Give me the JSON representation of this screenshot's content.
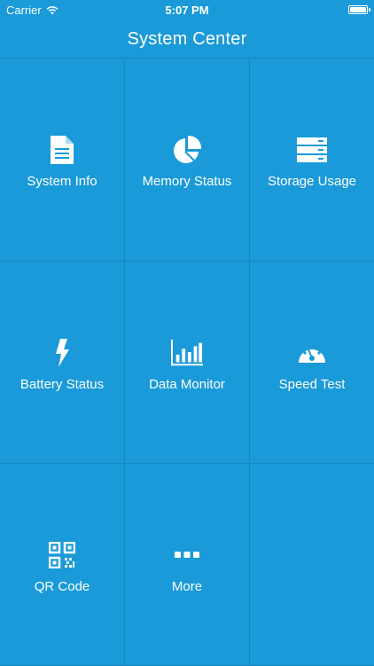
{
  "status_bar": {
    "carrier": "Carrier",
    "time": "5:07 PM"
  },
  "nav": {
    "title": "System Center"
  },
  "tiles": [
    {
      "label": "System Info",
      "icon": "document-icon"
    },
    {
      "label": "Memory Status",
      "icon": "pie-chart-icon"
    },
    {
      "label": "Storage Usage",
      "icon": "storage-icon"
    },
    {
      "label": "Battery Status",
      "icon": "lightning-icon"
    },
    {
      "label": "Data Monitor",
      "icon": "bar-chart-icon"
    },
    {
      "label": "Speed Test",
      "icon": "speedometer-icon"
    },
    {
      "label": "QR Code",
      "icon": "qr-code-icon"
    },
    {
      "label": "More",
      "icon": "more-dots-icon"
    },
    {
      "label": "",
      "icon": ""
    }
  ],
  "colors": {
    "background": "#1a9ad8",
    "divider": "#1487c1",
    "foreground": "#ffffff"
  }
}
